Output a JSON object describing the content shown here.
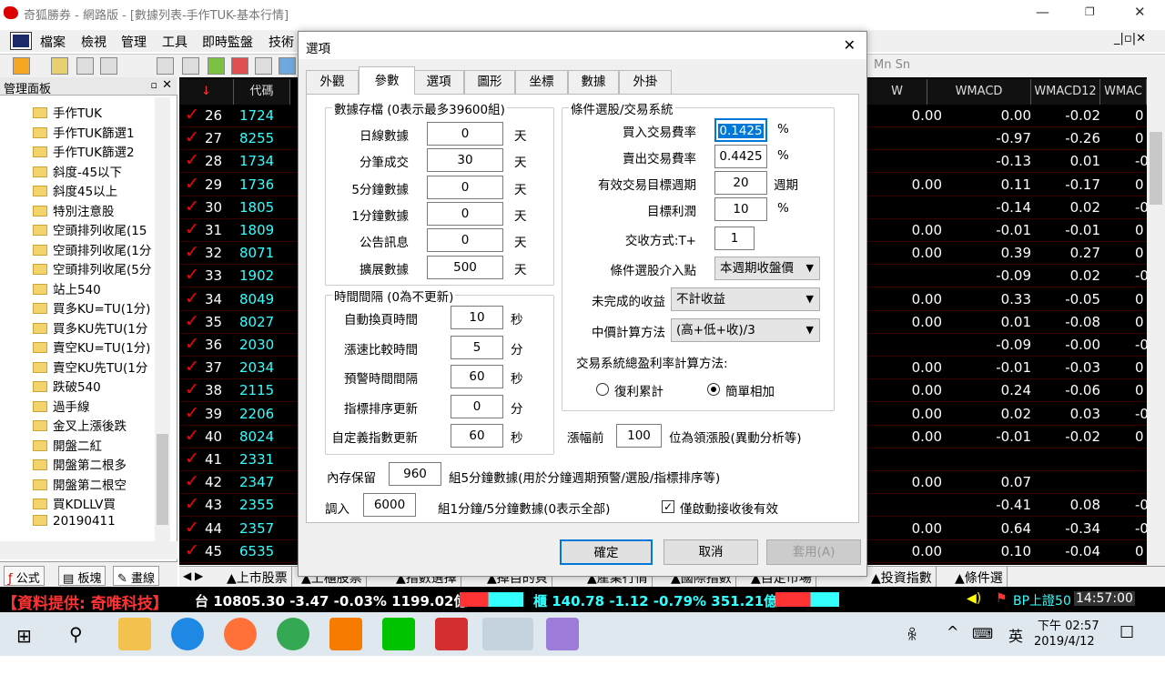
{
  "window": {
    "title": "奇狐勝券 - 網路版 - [數據列表-手作TUK-基本行情]"
  },
  "menu": [
    "檔案",
    "檢視",
    "管理",
    "工具",
    "即時監盤",
    "技術"
  ],
  "left_panel": {
    "title": "管理面板",
    "items": [
      "手作TUK",
      "手作TUK篩選1",
      "手作TUK篩選2",
      "斜度-45以下",
      "斜度45以上",
      "特別注意股",
      "空頭排列收尾(15",
      "空頭排列收尾(1分",
      "空頭排列收尾(5分",
      "站上540",
      "買多KU=TU(1分)",
      "買多KU先TU(1分",
      "賣空KU=TU(1分)",
      "賣空KU先TU(1分",
      "跌破540",
      "過手線",
      "金叉上漲後跌",
      "開盤二紅",
      "開盤第二根多",
      "開盤第二根空",
      "買KDLLV買",
      "20190411"
    ],
    "tabs": [
      "公式",
      "板塊",
      "畫線"
    ]
  },
  "grid": {
    "headers": {
      "code": "代碼",
      "w": "W",
      "wmacd": "WMACD",
      "wmacd12": "WMACD12",
      "wmac": "WMAC"
    },
    "rows": [
      {
        "n": "26",
        "code": "1724",
        "w": "0.00",
        "m": "0.00",
        "m12": "-0.02",
        "e": "0"
      },
      {
        "n": "27",
        "code": "8255",
        "w": "",
        "m": "-0.97",
        "m12": "-0.26",
        "e": "0"
      },
      {
        "n": "28",
        "code": "1734",
        "w": "",
        "m": "-0.13",
        "m12": "0.01",
        "e": "-0"
      },
      {
        "n": "29",
        "code": "1736",
        "w": "0.00",
        "m": "0.11",
        "m12": "-0.17",
        "e": "0"
      },
      {
        "n": "30",
        "code": "1805",
        "w": "",
        "m": "-0.14",
        "m12": "0.02",
        "e": "-0"
      },
      {
        "n": "31",
        "code": "1809",
        "w": "0.00",
        "m": "-0.01",
        "m12": "-0.01",
        "e": "0"
      },
      {
        "n": "32",
        "code": "8071",
        "w": "0.00",
        "m": "0.39",
        "m12": "0.27",
        "e": "0"
      },
      {
        "n": "33",
        "code": "1902",
        "w": "",
        "m": "-0.09",
        "m12": "0.02",
        "e": "-0"
      },
      {
        "n": "34",
        "code": "8049",
        "w": "0.00",
        "m": "0.33",
        "m12": "-0.05",
        "e": "0"
      },
      {
        "n": "35",
        "code": "8027",
        "w": "0.00",
        "m": "0.01",
        "m12": "-0.08",
        "e": "0"
      },
      {
        "n": "36",
        "code": "2030",
        "w": "",
        "m": "-0.09",
        "m12": "-0.00",
        "e": "-0"
      },
      {
        "n": "37",
        "code": "2034",
        "w": "0.00",
        "m": "-0.01",
        "m12": "-0.03",
        "e": "0"
      },
      {
        "n": "38",
        "code": "2115",
        "w": "0.00",
        "m": "0.24",
        "m12": "-0.06",
        "e": "0"
      },
      {
        "n": "39",
        "code": "2206",
        "w": "0.00",
        "m": "0.02",
        "m12": "0.03",
        "e": "-0"
      },
      {
        "n": "40",
        "code": "8024",
        "w": "0.00",
        "m": "-0.01",
        "m12": "-0.02",
        "e": "0"
      },
      {
        "n": "41",
        "code": "2331",
        "w": "",
        "m": "",
        "m12": "",
        "e": ""
      },
      {
        "n": "42",
        "code": "2347",
        "w": "0.00",
        "m": "0.07",
        "m12": "",
        "e": ""
      },
      {
        "n": "43",
        "code": "2355",
        "w": "",
        "m": "-0.41",
        "m12": "0.08",
        "e": "-0"
      },
      {
        "n": "44",
        "code": "2357",
        "w": "0.00",
        "m": "0.64",
        "m12": "-0.34",
        "e": "-0"
      },
      {
        "n": "45",
        "code": "6535",
        "w": "0.00",
        "m": "0.10",
        "m12": "-0.04",
        "e": "0"
      }
    ]
  },
  "bottom_tabs": [
    "上市股票",
    "上櫃股票",
    "指數選擇",
    "掉自的貝",
    "產業行情",
    "國際指數",
    "自定市場",
    "投資指數",
    "條件選"
  ],
  "ticker": {
    "source": "【資料提供: 奇唯科技】",
    "twse": "台 10805.30 -3.47 -0.03% 1199.02億",
    "otc": "櫃 140.78 -1.12 -0.79% 351.21億",
    "bp": "BP上證50",
    "time": "14:57:00"
  },
  "taskbar": {
    "ime": "英",
    "time": "下午 02:57",
    "date": "2019/4/12"
  },
  "dialog": {
    "title": "選項",
    "tabs": [
      "外觀",
      "參數",
      "選項",
      "圖形",
      "坐標",
      "數據",
      "外掛"
    ],
    "storage": {
      "title": "數據存檔 (0表示最多39600組)",
      "fields": [
        {
          "label": "日線數據",
          "value": "0",
          "unit": "天"
        },
        {
          "label": "分筆成交",
          "value": "30",
          "unit": "天"
        },
        {
          "label": "5分鐘數據",
          "value": "0",
          "unit": "天"
        },
        {
          "label": "1分鐘數據",
          "value": "0",
          "unit": "天"
        },
        {
          "label": "公告訊息",
          "value": "0",
          "unit": "天"
        },
        {
          "label": "擴展數據",
          "value": "500",
          "unit": "天"
        }
      ]
    },
    "interval": {
      "title": "時間間隔 (0為不更新)",
      "fields": [
        {
          "label": "自動換頁時間",
          "value": "10",
          "unit": "秒"
        },
        {
          "label": "漲速比較時間",
          "value": "5",
          "unit": "分"
        },
        {
          "label": "預警時間間隔",
          "value": "60",
          "unit": "秒"
        },
        {
          "label": "指標排序更新",
          "value": "0",
          "unit": "分"
        },
        {
          "label": "自定義指數更新",
          "value": "60",
          "unit": "秒"
        }
      ]
    },
    "cond": {
      "title": "條件選股/交易系統",
      "buy_label": "買入交易費率",
      "buy_value": "0.1425",
      "pct": "%",
      "sell_label": "賣出交易費率",
      "sell_value": "0.4425",
      "period_label": "有效交易目標週期",
      "period_value": "20",
      "period_unit": "週期",
      "profit_label": "目標利潤",
      "profit_value": "10",
      "settle_label": "交收方式:T+",
      "settle_value": "1",
      "entry_label": "條件選股介入點",
      "entry_value": "本週期收盤價",
      "unfinished_label": "未完成的收益",
      "unfinished_value": "不計收益",
      "mid_label": "中價計算方法",
      "mid_value": "(高+低+收)/3",
      "total_label": "交易系統總盈利率計算方法:",
      "radio1": "復利累計",
      "radio2": "簡單相加"
    },
    "rank_prefix": "漲幅前",
    "rank_value": "100",
    "rank_suffix": "位為領漲股(異動分析等)",
    "mem_prefix": "內存保留",
    "mem_value": "960",
    "mem_suffix": "組5分鐘數據(用於分鐘週期預警/選股/指標排序等)",
    "load_prefix": "調入",
    "load_value": "6000",
    "load_suffix": "組1分鐘/5分鐘數據(0表示全部)",
    "check_label": "僅啟動接收後有效",
    "ok": "確定",
    "cancel": "取消",
    "apply": "套用(A)"
  }
}
